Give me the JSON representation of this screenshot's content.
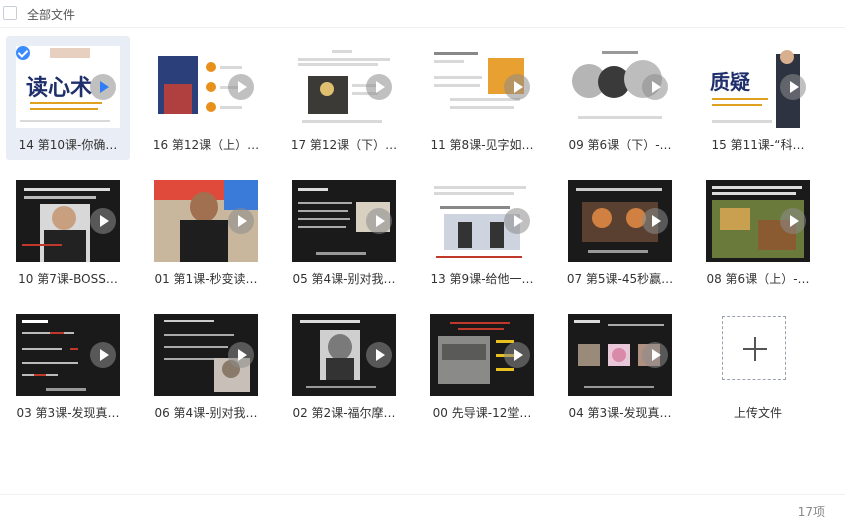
{
  "header": {
    "title": "全部文件"
  },
  "items": [
    {
      "name": "14 第10课-你确…",
      "art": "读心术"
    },
    {
      "name": "16 第12课（上）…"
    },
    {
      "name": "17 第12课（下）…"
    },
    {
      "name": "11 第8课-见字如…"
    },
    {
      "name": "09 第6课（下）-…"
    },
    {
      "name": "15 第11课-“科…",
      "art": "质疑"
    },
    {
      "name": "10 第7课-BOSS…"
    },
    {
      "name": "01 第1课-秒变读…"
    },
    {
      "name": "05 第4课-别对我…"
    },
    {
      "name": "13 第9课-给他一…"
    },
    {
      "name": "07 第5课-45秒赢…"
    },
    {
      "name": "08 第6课（上）-…"
    },
    {
      "name": "03 第3课-发现真…"
    },
    {
      "name": "06 第4课-别对我…"
    },
    {
      "name": "02 第2课-福尔摩…"
    },
    {
      "name": "00 先导课-12堂…"
    },
    {
      "name": "04 第3课-发现真…"
    }
  ],
  "upload": {
    "label": "上传文件"
  },
  "footer": {
    "count": "17项"
  },
  "colors": {
    "accent": "#2f7cf6",
    "selected_bg": "#e9eef6"
  }
}
